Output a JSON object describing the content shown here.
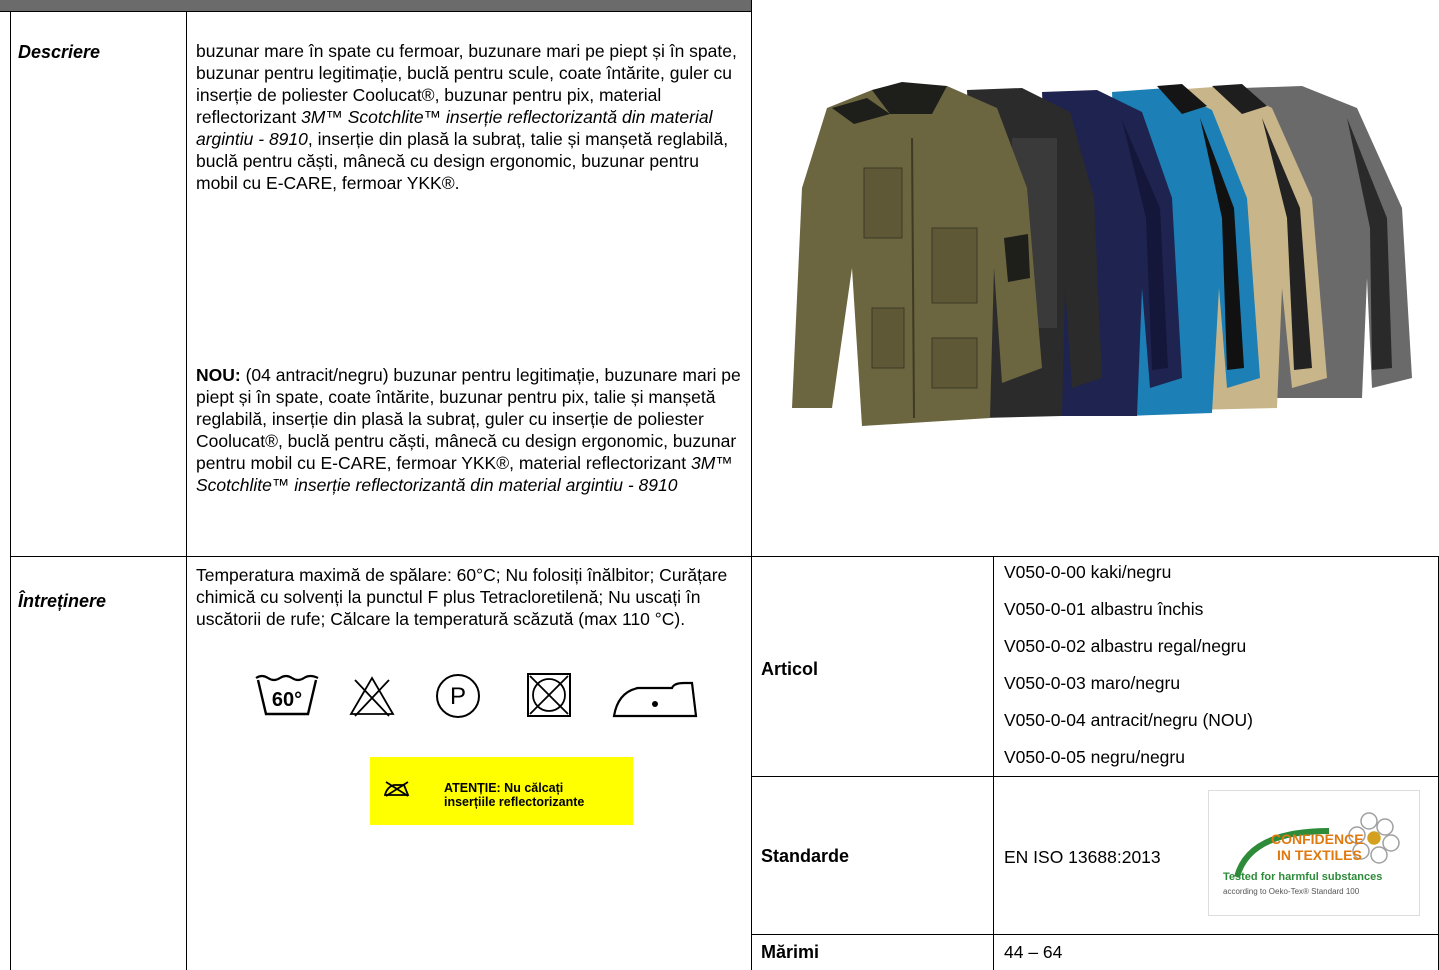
{
  "description": {
    "label": "Descriere",
    "text_main": "buzunar mare în spate cu fermoar, buzunare mari pe piept și în spate, buzunar pentru legitimație, buclă pentru scule, coate întărite, guler cu inserție de poliester Coolucat®, buzunar pentru pix, material reflectorizant ",
    "text_main_italic": "3M™ Scotchlite™ inserție reflectorizantă din material argintiu - 8910",
    "text_main_end": ", inserție din plasă la subraț, talie și manșetă reglabilă, buclă pentru căști, mânecă cu design ergonomic, buzunar pentru mobil cu E-CARE, fermoar YKK®.",
    "new_label": "NOU:",
    "new_text": " (04 antracit/negru) buzunar pentru legitimație, buzunare mari pe piept și în spate, coate întărite, buzunar pentru pix, talie și manșetă reglabilă, inserție din plasă la subraț, guler cu inserție de poliester Coolucat®, buclă pentru căști, mânecă cu design ergonomic, buzunar pentru mobil cu E-CARE, fermoar YKK®, material reflectorizant ",
    "new_text_italic": "3M™ Scotchlite™ inserție reflectorizantă din material argintiu - 8910"
  },
  "care": {
    "label": "Întreținere",
    "text": "Temperatura maximă de spălare: 60°C; Nu folosiți înălbitor; Curățare chimică cu solvenți la punctul F plus Tetracloretilenă; Nu uscați în uscătorii de rufe; Călcare la temperatură scăzută (max 110 °C).",
    "wash_temp": "60°",
    "dryclean_letter": "P",
    "warning": "ATENȚIE: Nu călcați inserțiile reflectorizante",
    "warning_bg": "#ffff00",
    "icons": [
      "wash-60-icon",
      "no-bleach-icon",
      "dry-clean-p-icon",
      "no-tumble-dry-icon",
      "iron-low-icon",
      "no-iron-icon"
    ]
  },
  "article": {
    "label": "Articol",
    "items": [
      "V050-0-00 kaki/negru",
      "V050-0-01 albastru închis",
      "V050-0-02 albastru regal/negru",
      "V050-0-03 maro/negru",
      "V050-0-04 antracit/negru (NOU)",
      "V050-0-05 negru/negru"
    ]
  },
  "standards": {
    "label": "Standarde",
    "value": "EN ISO 13688:2013",
    "logo_line1": "CONFIDENCE",
    "logo_line2": "IN TEXTILES",
    "logo_line3": "Tested for harmful substances",
    "logo_line4": "according to Oeko-Tex® Standard 100"
  },
  "sizes": {
    "label": "Mărimi",
    "value": "44 – 64"
  },
  "colors": {
    "header_bar": "#6b6b6b",
    "jackets": [
      "#6b6540",
      "#2b2b2b",
      "#1f2350",
      "#1c7fb5",
      "#c8b68a",
      "#6a6a6a"
    ]
  }
}
